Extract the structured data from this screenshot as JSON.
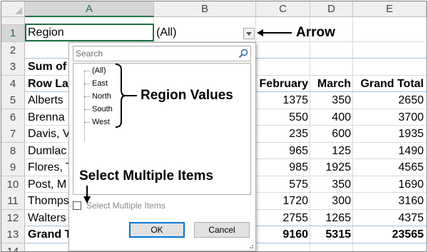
{
  "columns": [
    "A",
    "B",
    "C",
    "D",
    "E"
  ],
  "rows": [
    "1",
    "2",
    "3",
    "4",
    "5",
    "6",
    "7",
    "8",
    "9",
    "10",
    "11",
    "12",
    "13",
    "14"
  ],
  "cells": {
    "a1": "Region",
    "b1": "(All)",
    "a3": "Sum of",
    "a4": "Row La",
    "c4": "February",
    "d4": "March",
    "e4": "Grand Total",
    "a5": "Alberts",
    "a6": "Brenna",
    "a7": "Davis, V",
    "a8": "Dumlac",
    "a9": "Flores, T",
    "a10": "Post, M",
    "a11": "Thomps",
    "a12": "Walters",
    "a13": "Grand T"
  },
  "values": [
    {
      "feb": "1375",
      "mar": "350",
      "total": "2650"
    },
    {
      "feb": "550",
      "mar": "400",
      "total": "3700"
    },
    {
      "feb": "235",
      "mar": "600",
      "total": "1935"
    },
    {
      "feb": "965",
      "mar": "125",
      "total": "1490"
    },
    {
      "feb": "985",
      "mar": "1925",
      "total": "4565"
    },
    {
      "feb": "575",
      "mar": "350",
      "total": "1690"
    },
    {
      "feb": "1720",
      "mar": "300",
      "total": "3160"
    },
    {
      "feb": "2755",
      "mar": "1265",
      "total": "4375"
    },
    {
      "feb": "9160",
      "mar": "5315",
      "total": "23565"
    }
  ],
  "popup": {
    "search_placeholder": "Search",
    "items": [
      "(All)",
      "East",
      "North",
      "South",
      "West"
    ],
    "select_multiple_label": "Select Multiple Items",
    "ok_label": "OK",
    "cancel_label": "Cancel"
  },
  "annotations": {
    "arrow": "Arrow",
    "region_values": "Region Values",
    "select_multiple": "Select Multiple Items"
  },
  "colors": {
    "accent_green": "#217346",
    "pivot_band": "#9bc2e6",
    "ok_focus": "#0078d7"
  }
}
